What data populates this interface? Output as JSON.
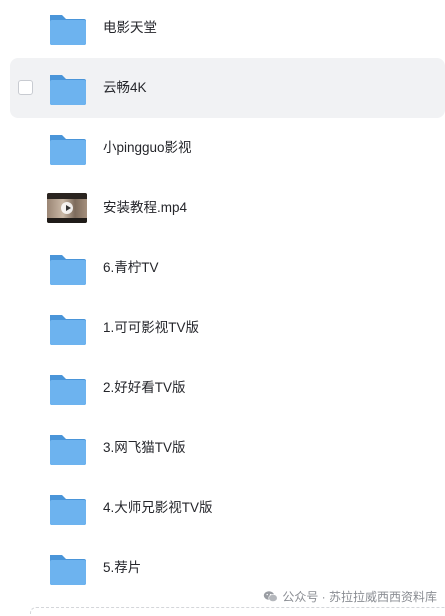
{
  "files": [
    {
      "name": "电影天堂",
      "type": "folder"
    },
    {
      "name": "云畅4K",
      "type": "folder"
    },
    {
      "name": "小pingguo影视",
      "type": "folder"
    },
    {
      "name": "安装教程.mp4",
      "type": "video"
    },
    {
      "name": "6.青柠TV",
      "type": "folder"
    },
    {
      "name": "1.可可影视TV版",
      "type": "folder"
    },
    {
      "name": "2.好好看TV版",
      "type": "folder"
    },
    {
      "name": "3.网飞猫TV版",
      "type": "folder"
    },
    {
      "name": "4.大师兄影视TV版",
      "type": "folder"
    },
    {
      "name": "5.荐片",
      "type": "folder"
    }
  ],
  "watermark": {
    "text": "公众号 · 苏拉拉威西西资料库",
    "icon": "wechat-icon"
  },
  "colors": {
    "folder": "#5fa8e8",
    "folder_tab": "#4a95d9",
    "hover_bg": "#f1f2f4"
  }
}
